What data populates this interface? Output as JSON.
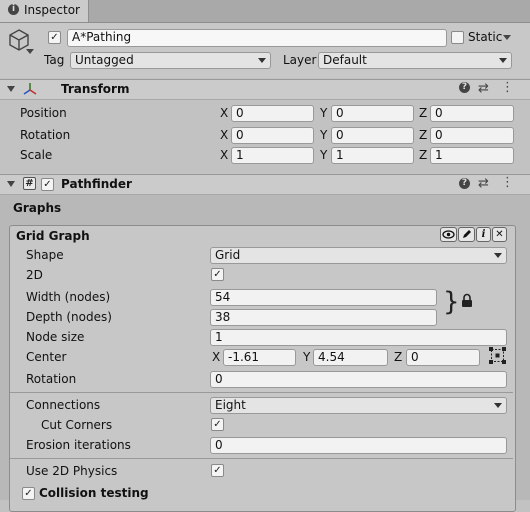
{
  "window": {
    "tab_title": "Inspector",
    "tab_icon": "info-icon"
  },
  "object": {
    "name": "A*Pathing",
    "active": true,
    "static_label": "Static",
    "tag_label": "Tag",
    "tag_value": "Untagged",
    "layer_label": "Layer",
    "layer_value": "Default",
    "icon": "cube-icon"
  },
  "transform": {
    "title": "Transform",
    "icon": "axes-icon",
    "rows": [
      {
        "label": "Position",
        "x": "0",
        "y": "0",
        "z": "0"
      },
      {
        "label": "Rotation",
        "x": "0",
        "y": "0",
        "z": "0"
      },
      {
        "label": "Scale",
        "x": "1",
        "y": "1",
        "z": "1"
      }
    ],
    "axis": {
      "x": "X",
      "y": "Y",
      "z": "Z"
    }
  },
  "pathfinder": {
    "title": "Pathfinder",
    "enabled": true,
    "script_icon": "#",
    "graphs_label": "Graphs",
    "grid_graph": {
      "title": "Grid Graph",
      "shape_label": "Shape",
      "shape_value": "Grid",
      "two_d_label": "2D",
      "two_d_checked": true,
      "width_label": "Width (nodes)",
      "width_value": "54",
      "depth_label": "Depth (nodes)",
      "depth_value": "38",
      "node_size_label": "Node size",
      "node_size_value": "1",
      "center_label": "Center",
      "center": {
        "x": "-1.61",
        "y": "4.54",
        "z": "0"
      },
      "rotation_label": "Rotation",
      "rotation_value": "0",
      "connections_label": "Connections",
      "connections_value": "Eight",
      "cut_corners_label": "Cut Corners",
      "cut_corners_checked": true,
      "erosion_label": "Erosion iterations",
      "erosion_value": "0",
      "use_2d_physics_label": "Use 2D Physics",
      "use_2d_physics_checked": true,
      "collision_label": "Collision testing",
      "collision_checked": true
    }
  },
  "glyphs": {
    "check": "✓",
    "info": "i",
    "close": "✕",
    "hash": "#"
  }
}
